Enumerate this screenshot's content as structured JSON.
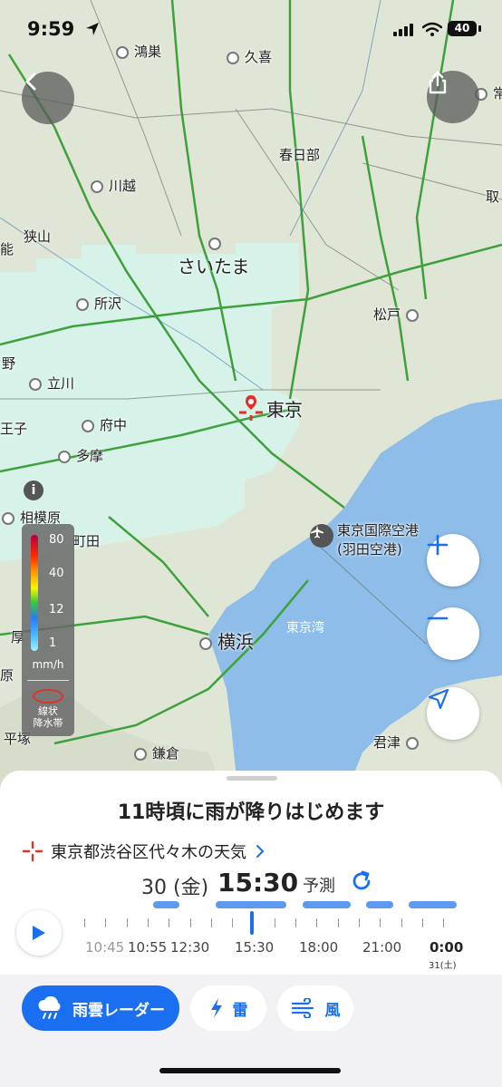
{
  "status_bar": {
    "time": "9:59",
    "battery": "40"
  },
  "map": {
    "places": [
      {
        "name": "鴻巣",
        "dot": true
      },
      {
        "name": "久喜",
        "dot": true
      },
      {
        "name": "川越",
        "dot": true
      },
      {
        "name": "春日部",
        "dot": false
      },
      {
        "name": "狭山",
        "dot": false
      },
      {
        "name": "さいたま",
        "dot": true
      },
      {
        "name": "所沢",
        "dot": true
      },
      {
        "name": "松戸",
        "dot": true
      },
      {
        "name": "立川",
        "dot": true
      },
      {
        "name": "東京",
        "dot": false
      },
      {
        "name": "府中",
        "dot": true
      },
      {
        "name": "多摩",
        "dot": true
      },
      {
        "name": "相模原",
        "dot": true
      },
      {
        "name": "町田",
        "dot": false
      },
      {
        "name": "東京国際空港",
        "dot": false
      },
      {
        "name": "(羽田空港)",
        "dot": false
      },
      {
        "name": "東京湾",
        "dot": false
      },
      {
        "name": "横浜",
        "dot": true
      },
      {
        "name": "鎌倉",
        "dot": true
      },
      {
        "name": "君津",
        "dot": true
      },
      {
        "name": "常",
        "dot": false
      },
      {
        "name": "取",
        "dot": false
      },
      {
        "name": "能",
        "dot": false
      },
      {
        "name": "野",
        "dot": false
      },
      {
        "name": "王子",
        "dot": false
      },
      {
        "name": "厚",
        "dot": false
      },
      {
        "name": "原",
        "dot": false
      },
      {
        "name": "平塚",
        "dot": false
      }
    ]
  },
  "legend": {
    "values": [
      "80",
      "40",
      "12",
      "1"
    ],
    "unit": "mm/h",
    "band_label": "線状\n降水帯",
    "colors": [
      "#b4003c",
      "#ff2800",
      "#ff9900",
      "#faf500",
      "#3cc83c",
      "#2a7cf0",
      "#49b7ff",
      "#a0f0ff"
    ]
  },
  "sheet": {
    "headline": "11時頃に雨が降りはじめます",
    "location": "東京都渋谷区代々木の天気",
    "date": "30 (金)",
    "current_time": "15:30",
    "mode": "予測",
    "timeline_labels": [
      "10:45",
      "10:55",
      "12:30",
      "15:30",
      "18:00",
      "21:00",
      "0:00"
    ],
    "next_day": "31(土)"
  },
  "tabs": [
    {
      "label": "雨雲レーダー",
      "active": true
    },
    {
      "label": "雷",
      "active": false
    },
    {
      "label": "風",
      "active": false
    }
  ],
  "colors": {
    "accent": "#1a6ff0",
    "sea": "#8dbde8",
    "rain": "#d8f4ec"
  }
}
